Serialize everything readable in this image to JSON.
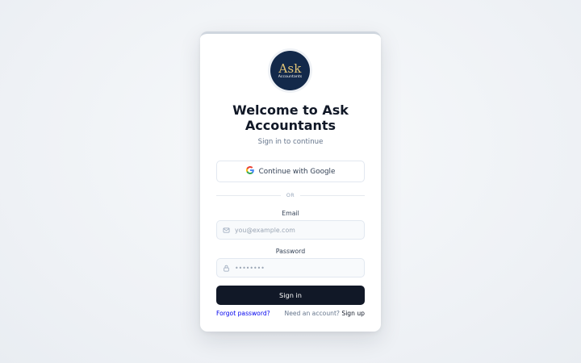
{
  "logo": {
    "primary": "Ask",
    "secondary": "Accountants",
    "background": "#13294a",
    "accent": "#e2c576"
  },
  "header": {
    "title": "Welcome to Ask Accountants",
    "subtitle": "Sign in to continue"
  },
  "google_button": {
    "label": "Continue with Google",
    "icon": "google-icon"
  },
  "divider": {
    "label": "OR"
  },
  "email": {
    "label": "Email",
    "placeholder": "you@example.com",
    "value": "",
    "icon": "mail-icon"
  },
  "password": {
    "label": "Password",
    "placeholder": "••••••••",
    "value": "",
    "icon": "lock-icon"
  },
  "signin_button": {
    "label": "Sign in",
    "background": "#111827"
  },
  "footer": {
    "forgot_password": "Forgot password?",
    "need_account": "Need an account?",
    "sign_up": "Sign up"
  }
}
